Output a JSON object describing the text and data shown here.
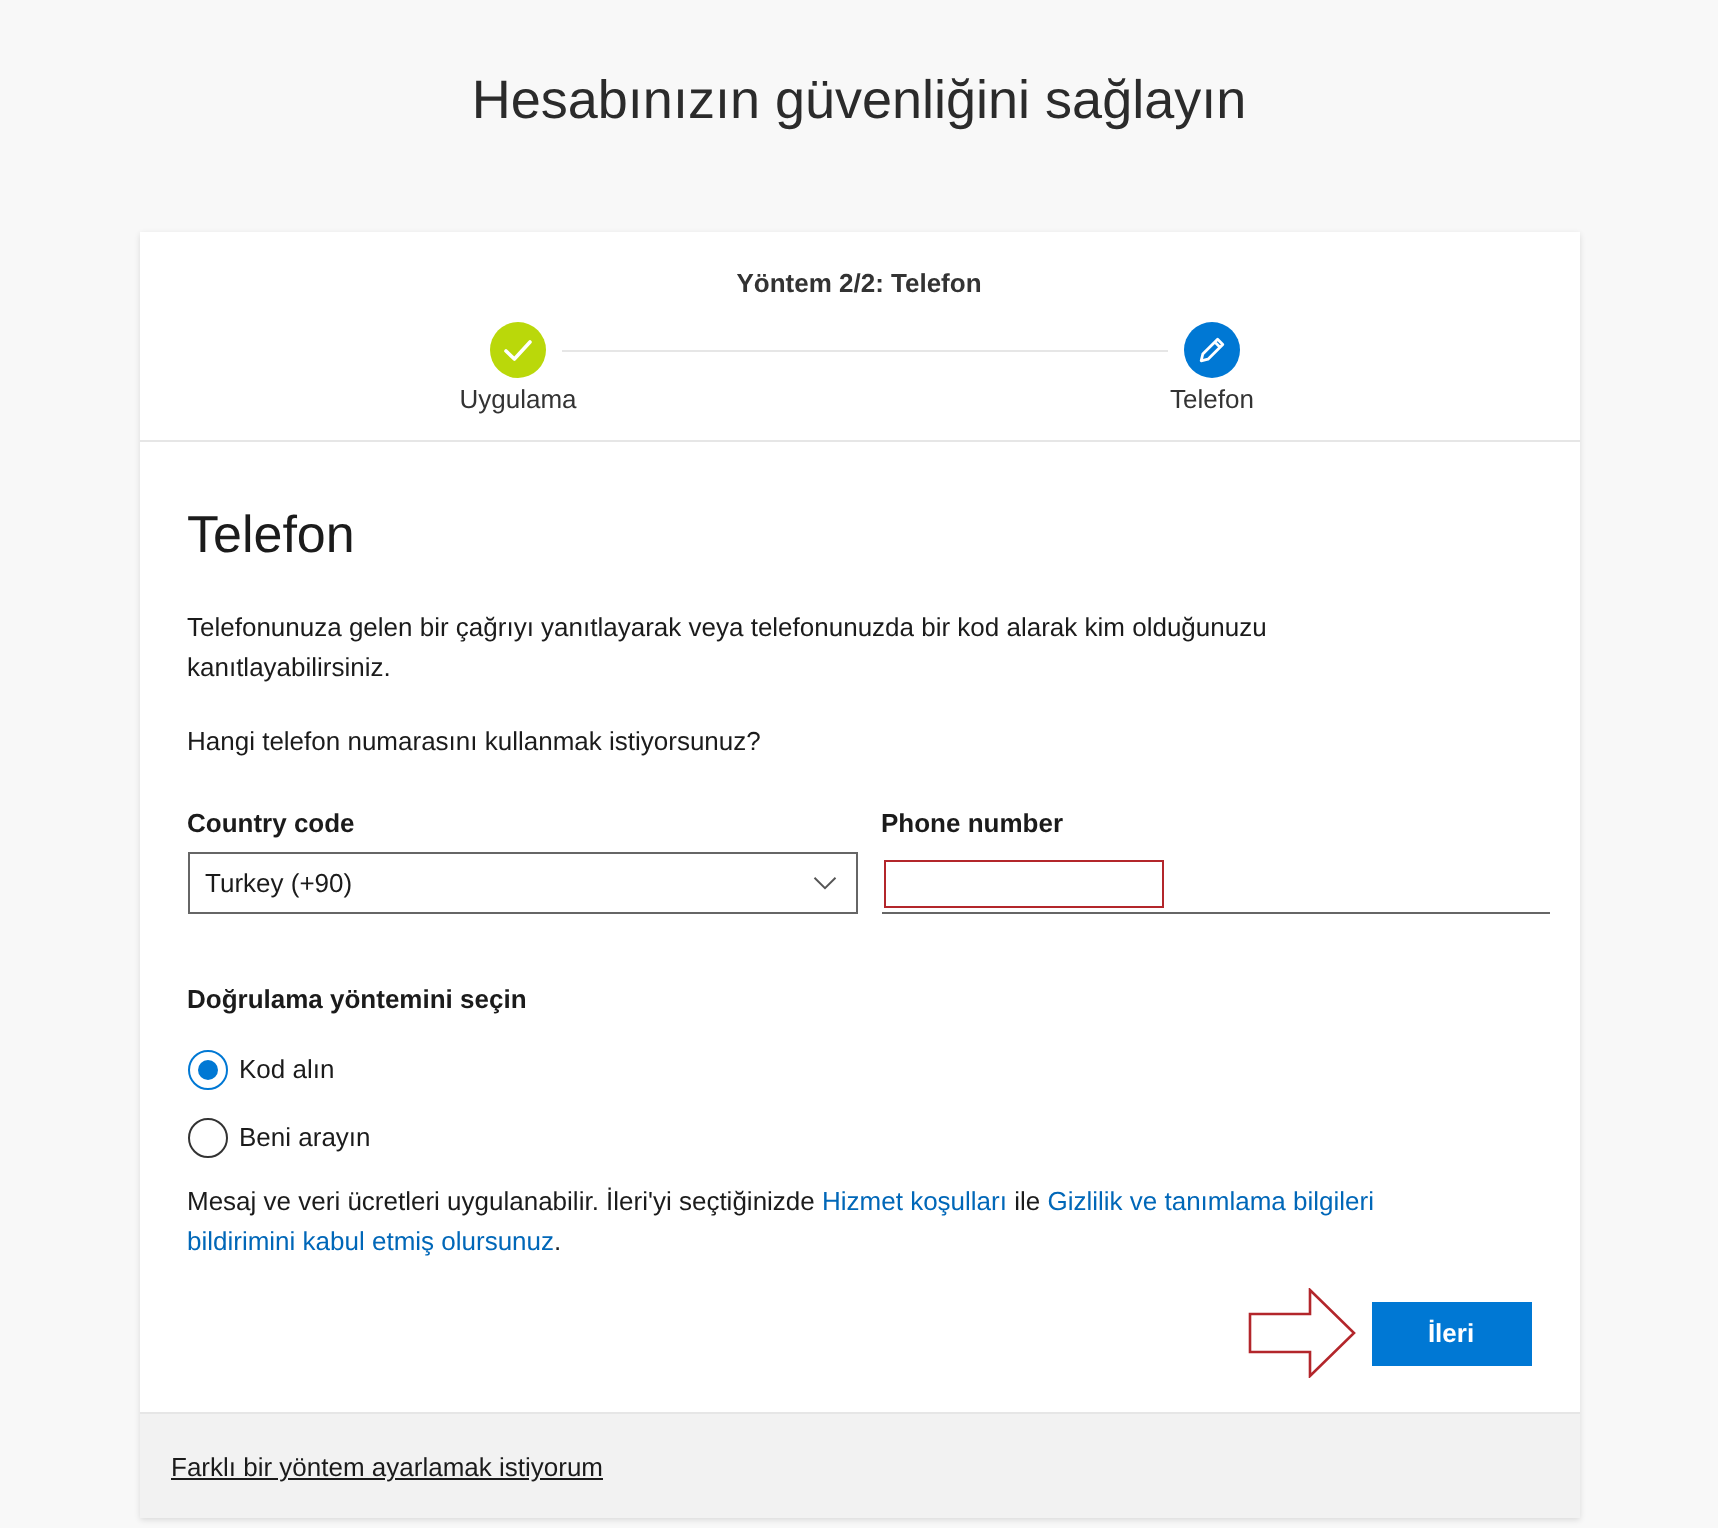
{
  "page": {
    "title": "Hesabınızın güvenliğini sağlayın"
  },
  "progress": {
    "title": "Yöntem 2/2: Telefon",
    "steps": [
      {
        "label": "Uygulama",
        "completed": true
      },
      {
        "label": "Telefon",
        "completed": false
      }
    ]
  },
  "section": {
    "heading": "Telefon",
    "description": "Telefonunuza gelen bir çağrıyı yanıtlayarak veya telefonunuzda bir kod alarak kim olduğunuzu kanıtlayabilirsiniz.",
    "question": "Hangi telefon numarasını kullanmak istiyorsunuz?"
  },
  "country_code": {
    "label": "Country code",
    "value": "Turkey (+90)"
  },
  "phone_number": {
    "label": "Phone number",
    "highlighted": true
  },
  "verification": {
    "label": "Doğrulama yöntemini seçin",
    "options": [
      {
        "label": "Kod alın",
        "selected": true
      },
      {
        "label": "Beni arayın",
        "selected": false
      }
    ]
  },
  "disclaimer": [
    {
      "kind": "text",
      "text": "Mesaj ve veri ücretleri uygulanabilir. İleri'yi seçtiğinizde "
    },
    {
      "kind": "link",
      "text": "Hizmet koşulları"
    },
    {
      "kind": "text",
      "text": " ile "
    },
    {
      "kind": "link",
      "text": "Gizlilik ve tanımlama bilgileri"
    },
    {
      "kind": "link",
      "text": "bildirimini kabul etmiş olursunuz"
    },
    {
      "kind": "text",
      "text": "."
    }
  ],
  "next_button": {
    "label": "İleri",
    "pointed_at": true
  },
  "footer_link": "Farklı bir yöntem ayarlamak istiyorum"
}
